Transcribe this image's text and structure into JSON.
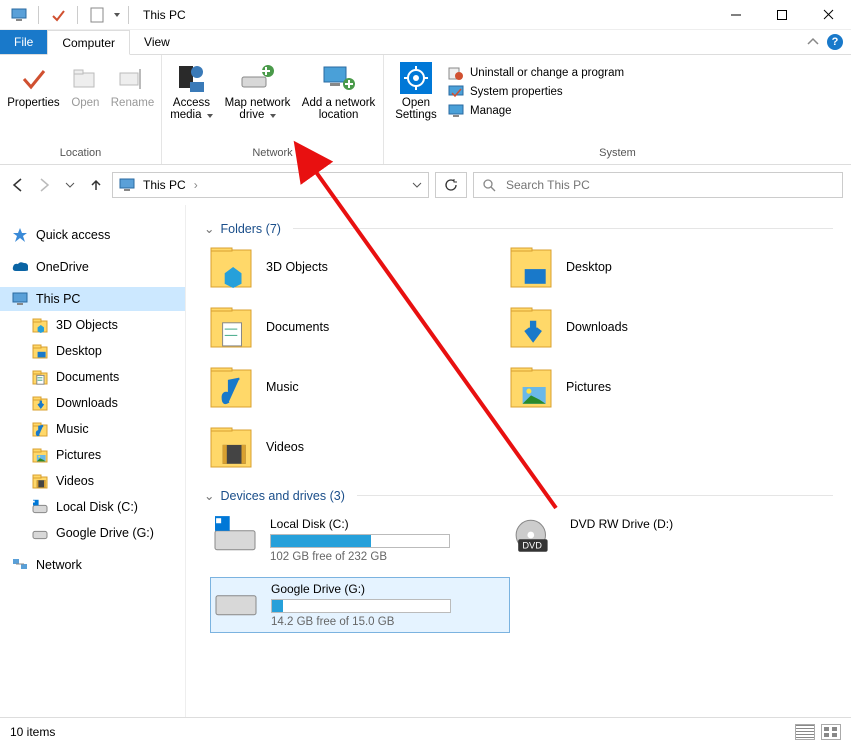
{
  "window": {
    "title": "This PC",
    "minimize_tooltip": "Minimize",
    "maximize_tooltip": "Maximize",
    "close_tooltip": "Close"
  },
  "tabs": {
    "file": "File",
    "computer": "Computer",
    "view": "View"
  },
  "ribbon": {
    "location": {
      "group": "Location",
      "properties": "Properties",
      "open": "Open",
      "rename": "Rename"
    },
    "network": {
      "group": "Network",
      "access_media": "Access media",
      "map_network_drive": "Map network drive",
      "add_network_location": "Add a network location"
    },
    "system": {
      "group": "System",
      "open_settings": "Open Settings",
      "uninstall": "Uninstall or change a program",
      "system_props": "System properties",
      "manage": "Manage"
    }
  },
  "address_bar": {
    "location": "This PC"
  },
  "search": {
    "placeholder": "Search This PC"
  },
  "nav_pane": {
    "quick_access": "Quick access",
    "onedrive": "OneDrive",
    "this_pc": "This PC",
    "children": [
      {
        "label": "3D Objects",
        "icon": "3dobjects"
      },
      {
        "label": "Desktop",
        "icon": "desktop"
      },
      {
        "label": "Documents",
        "icon": "documents"
      },
      {
        "label": "Downloads",
        "icon": "downloads"
      },
      {
        "label": "Music",
        "icon": "music"
      },
      {
        "label": "Pictures",
        "icon": "pictures"
      },
      {
        "label": "Videos",
        "icon": "videos"
      },
      {
        "label": "Local Disk (C:)",
        "icon": "localdisk"
      },
      {
        "label": "Google Drive (G:)",
        "icon": "drive"
      }
    ],
    "network": "Network"
  },
  "sections": {
    "folders": {
      "title": "Folders",
      "count": 7,
      "items": [
        {
          "label": "3D Objects",
          "icon": "3dobjects"
        },
        {
          "label": "Desktop",
          "icon": "desktop"
        },
        {
          "label": "Documents",
          "icon": "documents"
        },
        {
          "label": "Downloads",
          "icon": "downloads"
        },
        {
          "label": "Music",
          "icon": "music"
        },
        {
          "label": "Pictures",
          "icon": "pictures"
        },
        {
          "label": "Videos",
          "icon": "videos"
        }
      ]
    },
    "drives": {
      "title": "Devices and drives",
      "count": 3,
      "items": [
        {
          "label": "Local Disk (C:)",
          "free": "102 GB free of 232 GB",
          "fill_pct": 56,
          "icon": "localdisk",
          "selected": false
        },
        {
          "label": "DVD RW Drive (D:)",
          "free": "",
          "fill_pct": null,
          "icon": "dvd",
          "selected": false
        },
        {
          "label": "Google Drive (G:)",
          "free": "14.2 GB free of 15.0 GB",
          "fill_pct": 6,
          "icon": "drive",
          "selected": true
        }
      ]
    }
  },
  "statusbar": {
    "items": "10 items"
  }
}
